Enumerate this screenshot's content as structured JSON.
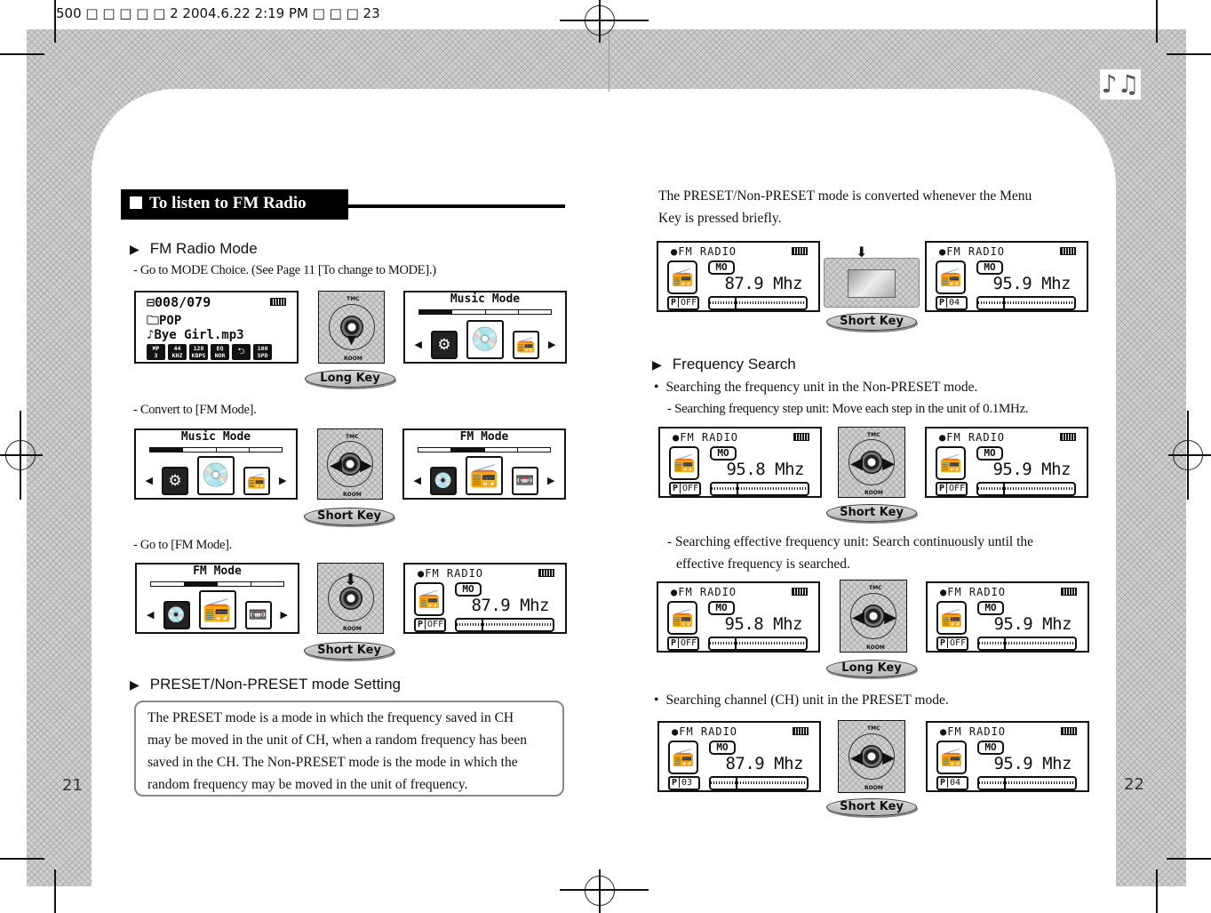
{
  "slug": "500 □ □ □ □ □ 2 2004.6.22 2:19 PM □ □ □ 23",
  "page_numbers": {
    "left": "21",
    "right": "22"
  },
  "section_title": "To listen to FM Radio",
  "left": {
    "fm_radio_mode": {
      "heading": "FM Radio Mode",
      "step1": "- Go to MODE Choice. (See Page 11 [To change to MODE].)",
      "step2": "- Convert to [FM Mode].",
      "step3": "- Go to [FM Mode]."
    },
    "preset_heading": "PRESET/Non-PRESET mode Setting",
    "preset_note": [
      "The PRESET mode is a mode in which the frequency saved in CH",
      "may be moved in the unit of CH, when a random frequency has been",
      "saved in the CH.  The Non-PRESET mode is the mode in which the",
      "random frequency may be moved in the unit of frequency."
    ]
  },
  "right": {
    "intro": [
      "The PRESET/Non-PRESET mode is converted whenever the Menu",
      "Key  is pressed briefly."
    ],
    "freq_search_heading": "Frequency Search",
    "bullet1": "Searching the frequency unit in the Non-PRESET mode.",
    "bullet1_sub1": "- Searching frequency step unit: Move each step in the unit of 0.1MHz.",
    "bullet1_sub2": [
      "- Searching effective frequency unit: Search continuously until the",
      "effective frequency is searched."
    ],
    "bullet2": "Searching channel (CH) unit in the PRESET mode."
  },
  "keys": {
    "long": "Long Key",
    "short": "Short Key"
  },
  "player_screen": {
    "track": "008/079",
    "folder": "POP",
    "file": "Bye Girl.mp3",
    "badges": [
      [
        "MP",
        "3"
      ],
      [
        "44",
        "KHZ"
      ],
      [
        "128",
        "KBPS"
      ],
      [
        "EQ",
        "NOR"
      ],
      [
        "⮌",
        ""
      ],
      [
        "100",
        "SPD"
      ]
    ]
  },
  "mode_screens": {
    "music": "Music Mode",
    "fm": "FM Mode"
  },
  "fm_screen": {
    "title": "●FM RADIO",
    "mono": "MO",
    "unit": "Mhz",
    "preset_prefix": "P"
  },
  "fm_states": {
    "go_fm": {
      "freq": "87.9",
      "preset": "OFF"
    },
    "conv_before": {
      "freq": "87.9",
      "preset": "OFF"
    },
    "conv_after": {
      "freq": "95.9",
      "preset": "04"
    },
    "step_before": {
      "freq": "95.8",
      "preset": "OFF"
    },
    "step_after": {
      "freq": "95.9",
      "preset": "OFF"
    },
    "eff_before": {
      "freq": "95.8",
      "preset": "OFF"
    },
    "eff_after": {
      "freq": "95.9",
      "preset": "OFF"
    },
    "ch_before": {
      "freq": "87.9",
      "preset": "03"
    },
    "ch_after": {
      "freq": "95.9",
      "preset": "04"
    }
  },
  "keypad_labels": {
    "top": "TMC",
    "bottom": "ROOM",
    "left": "REW",
    "right": "FF",
    "center": "⏯"
  }
}
